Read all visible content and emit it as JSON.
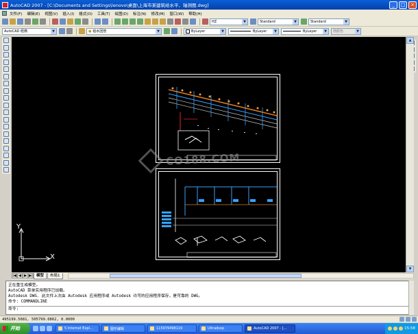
{
  "window": {
    "title": "AutoCAD 2007 - [C:\\Documents and Settings\\lenovo\\桌面\\上海市某建筑给水平、轴测图.dwg]"
  },
  "menu": {
    "items": [
      "文件(F)",
      "编辑(E)",
      "视图(V)",
      "插入(I)",
      "格式(O)",
      "工具(T)",
      "绘图(D)",
      "标注(N)",
      "修改(M)",
      "窗口(W)",
      "帮助(H)"
    ]
  },
  "toolbar1": {
    "text_style": "HZ",
    "dim_style": "Standard",
    "table_style": "Standard"
  },
  "toolbar2": {
    "workspace": "AutoCAD 经典",
    "layer": "给水回管",
    "color": "ByLayer",
    "linetype": "ByLayer",
    "lineweight": "ByLayer",
    "plotstyle": "随颜色"
  },
  "layout_tabs": [
    "模型",
    "布局1"
  ],
  "command_lines": [
    "正在重生成模型。",
    "AutoCAD 菜单实用程序已加载。",
    "Autodesk DWG.  此文件上次由 Autodesk 应用程序或 Autodesk 许可的应用程序保存，是可靠的 DWG。",
    "命令: COMMANDLINE"
  ],
  "command_prompt": "命令:",
  "status": {
    "coords": "495199.5681, 505799.0862, 0.0000"
  },
  "ucs": {
    "y_label": "Y",
    "x_label": "X"
  },
  "watermark": {
    "text": "CO188.COM"
  },
  "taskbar": {
    "start_label": "开始",
    "tasks": [
      "5 Internet Expl...",
      "图形编辑",
      "115979498119",
      "Ultradsop",
      "AutoCAD 2007 - [..."
    ],
    "clock": "15:58"
  }
}
